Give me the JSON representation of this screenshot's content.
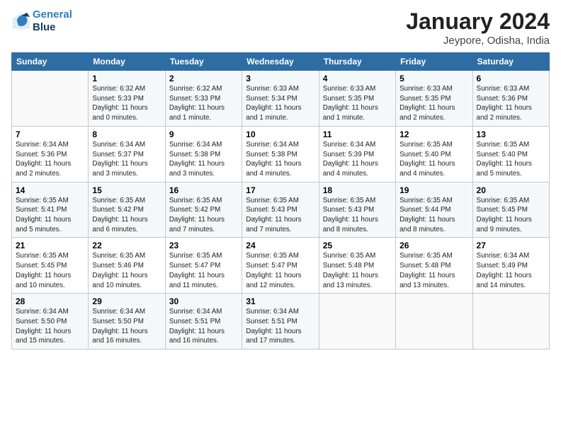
{
  "header": {
    "logo_line1": "General",
    "logo_line2": "Blue",
    "title": "January 2024",
    "subtitle": "Jeypore, Odisha, India"
  },
  "days_of_week": [
    "Sunday",
    "Monday",
    "Tuesday",
    "Wednesday",
    "Thursday",
    "Friday",
    "Saturday"
  ],
  "weeks": [
    [
      {
        "day": "",
        "info": ""
      },
      {
        "day": "1",
        "info": "Sunrise: 6:32 AM\nSunset: 5:33 PM\nDaylight: 11 hours\nand 0 minutes."
      },
      {
        "day": "2",
        "info": "Sunrise: 6:32 AM\nSunset: 5:33 PM\nDaylight: 11 hours\nand 1 minute."
      },
      {
        "day": "3",
        "info": "Sunrise: 6:33 AM\nSunset: 5:34 PM\nDaylight: 11 hours\nand 1 minute."
      },
      {
        "day": "4",
        "info": "Sunrise: 6:33 AM\nSunset: 5:35 PM\nDaylight: 11 hours\nand 1 minute."
      },
      {
        "day": "5",
        "info": "Sunrise: 6:33 AM\nSunset: 5:35 PM\nDaylight: 11 hours\nand 2 minutes."
      },
      {
        "day": "6",
        "info": "Sunrise: 6:33 AM\nSunset: 5:36 PM\nDaylight: 11 hours\nand 2 minutes."
      }
    ],
    [
      {
        "day": "7",
        "info": "Sunrise: 6:34 AM\nSunset: 5:36 PM\nDaylight: 11 hours\nand 2 minutes."
      },
      {
        "day": "8",
        "info": "Sunrise: 6:34 AM\nSunset: 5:37 PM\nDaylight: 11 hours\nand 3 minutes."
      },
      {
        "day": "9",
        "info": "Sunrise: 6:34 AM\nSunset: 5:38 PM\nDaylight: 11 hours\nand 3 minutes."
      },
      {
        "day": "10",
        "info": "Sunrise: 6:34 AM\nSunset: 5:38 PM\nDaylight: 11 hours\nand 4 minutes."
      },
      {
        "day": "11",
        "info": "Sunrise: 6:34 AM\nSunset: 5:39 PM\nDaylight: 11 hours\nand 4 minutes."
      },
      {
        "day": "12",
        "info": "Sunrise: 6:35 AM\nSunset: 5:40 PM\nDaylight: 11 hours\nand 4 minutes."
      },
      {
        "day": "13",
        "info": "Sunrise: 6:35 AM\nSunset: 5:40 PM\nDaylight: 11 hours\nand 5 minutes."
      }
    ],
    [
      {
        "day": "14",
        "info": "Sunrise: 6:35 AM\nSunset: 5:41 PM\nDaylight: 11 hours\nand 5 minutes."
      },
      {
        "day": "15",
        "info": "Sunrise: 6:35 AM\nSunset: 5:42 PM\nDaylight: 11 hours\nand 6 minutes."
      },
      {
        "day": "16",
        "info": "Sunrise: 6:35 AM\nSunset: 5:42 PM\nDaylight: 11 hours\nand 7 minutes."
      },
      {
        "day": "17",
        "info": "Sunrise: 6:35 AM\nSunset: 5:43 PM\nDaylight: 11 hours\nand 7 minutes."
      },
      {
        "day": "18",
        "info": "Sunrise: 6:35 AM\nSunset: 5:43 PM\nDaylight: 11 hours\nand 8 minutes."
      },
      {
        "day": "19",
        "info": "Sunrise: 6:35 AM\nSunset: 5:44 PM\nDaylight: 11 hours\nand 8 minutes."
      },
      {
        "day": "20",
        "info": "Sunrise: 6:35 AM\nSunset: 5:45 PM\nDaylight: 11 hours\nand 9 minutes."
      }
    ],
    [
      {
        "day": "21",
        "info": "Sunrise: 6:35 AM\nSunset: 5:45 PM\nDaylight: 11 hours\nand 10 minutes."
      },
      {
        "day": "22",
        "info": "Sunrise: 6:35 AM\nSunset: 5:46 PM\nDaylight: 11 hours\nand 10 minutes."
      },
      {
        "day": "23",
        "info": "Sunrise: 6:35 AM\nSunset: 5:47 PM\nDaylight: 11 hours\nand 11 minutes."
      },
      {
        "day": "24",
        "info": "Sunrise: 6:35 AM\nSunset: 5:47 PM\nDaylight: 11 hours\nand 12 minutes."
      },
      {
        "day": "25",
        "info": "Sunrise: 6:35 AM\nSunset: 5:48 PM\nDaylight: 11 hours\nand 13 minutes."
      },
      {
        "day": "26",
        "info": "Sunrise: 6:35 AM\nSunset: 5:48 PM\nDaylight: 11 hours\nand 13 minutes."
      },
      {
        "day": "27",
        "info": "Sunrise: 6:34 AM\nSunset: 5:49 PM\nDaylight: 11 hours\nand 14 minutes."
      }
    ],
    [
      {
        "day": "28",
        "info": "Sunrise: 6:34 AM\nSunset: 5:50 PM\nDaylight: 11 hours\nand 15 minutes."
      },
      {
        "day": "29",
        "info": "Sunrise: 6:34 AM\nSunset: 5:50 PM\nDaylight: 11 hours\nand 16 minutes."
      },
      {
        "day": "30",
        "info": "Sunrise: 6:34 AM\nSunset: 5:51 PM\nDaylight: 11 hours\nand 16 minutes."
      },
      {
        "day": "31",
        "info": "Sunrise: 6:34 AM\nSunset: 5:51 PM\nDaylight: 11 hours\nand 17 minutes."
      },
      {
        "day": "",
        "info": ""
      },
      {
        "day": "",
        "info": ""
      },
      {
        "day": "",
        "info": ""
      }
    ]
  ]
}
